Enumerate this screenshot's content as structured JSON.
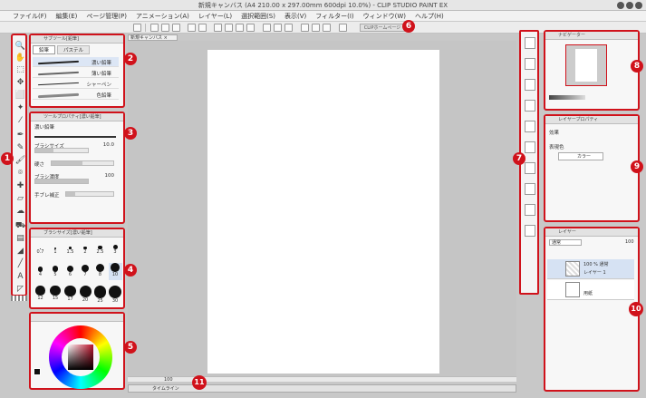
{
  "window": {
    "title": "新規キャンバス (A4 210.00 x 297.00mm 600dpi 10.0%) - CLIP STUDIO PAINT EX"
  },
  "menu": [
    "ファイル(F)",
    "編集(E)",
    "ページ管理(P)",
    "アニメーション(A)",
    "レイヤー(L)",
    "選択範囲(S)",
    "表示(V)",
    "フィルター(I)",
    "ウィンドウ(W)",
    "ヘルプ(H)"
  ],
  "toolbar": {
    "clip_home": "CLIPホームページ"
  },
  "canvas": {
    "tab_label": "新規キャンバス",
    "zoom": "100",
    "timeline_label": "タイムライン"
  },
  "sub_tool": {
    "title": "サブツール[鉛筆]",
    "tabs": [
      "鉛筆",
      "パステル"
    ],
    "brushes": [
      "濃い鉛筆",
      "薄い鉛筆",
      "シャーペン",
      "色鉛筆"
    ]
  },
  "tool_property": {
    "title": "ツールプロパティ[濃い鉛筆]",
    "name": "濃い鉛筆",
    "rows": [
      {
        "label": "ブラシサイズ",
        "value": "10.0",
        "fill": 0.35
      },
      {
        "label": "硬さ",
        "value": "",
        "fill": 0.5
      },
      {
        "label": "ブラシ濃度",
        "value": "100",
        "fill": 1.0
      },
      {
        "label": "手ブレ補正",
        "value": "",
        "fill": 0.2
      }
    ]
  },
  "brush_size": {
    "title": "ブラシサイズ[濃い鉛筆]",
    "sizes": [
      "0.7",
      "1",
      "1.5",
      "2",
      "2.5",
      "3",
      "4",
      "5",
      "6",
      "7",
      "8",
      "10",
      "12",
      "15",
      "17",
      "20",
      "25",
      "30"
    ]
  },
  "color": {
    "title": "カラーサークル",
    "accent": "#d0121b"
  },
  "navigator": {
    "title": "ナビゲーター"
  },
  "layer_property": {
    "title": "レイヤープロパティ",
    "effect_label": "効果",
    "expression_label": "表現色",
    "expression_value": "カラー"
  },
  "layers": {
    "title": "レイヤー",
    "blend_mode": "通常",
    "opacity": "100",
    "items": [
      {
        "name": "レイヤー 1",
        "meta": "100 % 通常"
      },
      {
        "name": "用紙",
        "meta": ""
      }
    ]
  },
  "badges": [
    "1",
    "2",
    "3",
    "4",
    "5",
    "6",
    "7",
    "8",
    "9",
    "10",
    "11"
  ]
}
